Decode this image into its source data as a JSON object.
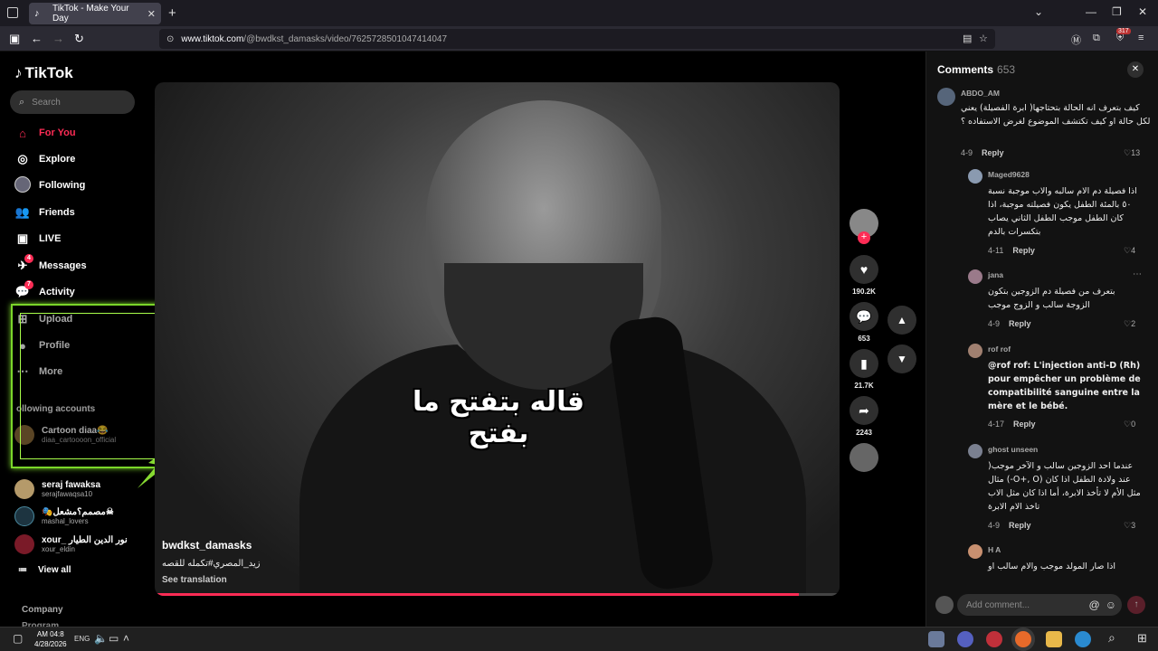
{
  "browser": {
    "tab_title": "TikTok - Make Your Day",
    "new_tab": "+",
    "url_domain": "www.tiktok.com",
    "url_path": "/@bwdkst_damasks/video/7625728501047414047",
    "ext_badge": "317"
  },
  "sidebar": {
    "logo": "TikTok",
    "search_placeholder": "Search",
    "nav": [
      {
        "label": "For You",
        "icon": "home-icon"
      },
      {
        "label": "Explore",
        "icon": "compass-icon"
      },
      {
        "label": "Following",
        "icon": "following-avatar-icon"
      },
      {
        "label": "Friends",
        "icon": "friends-icon"
      },
      {
        "label": "LIVE",
        "icon": "live-icon"
      },
      {
        "label": "Messages",
        "icon": "messages-icon",
        "badge": "4"
      },
      {
        "label": "Activity",
        "icon": "activity-icon",
        "badge": "7"
      },
      {
        "label": "Upload",
        "icon": "upload-icon"
      },
      {
        "label": "Profile",
        "icon": "profile-icon"
      },
      {
        "label": "More",
        "icon": "more-icon"
      }
    ],
    "following_title": "ollowing accounts",
    "accounts": [
      {
        "name": "Cartoon diaa😂",
        "handle": "diaa_cartoooon_official"
      },
      {
        "name": "seraj fawaksa",
        "handle": "serajfawaqsa10"
      },
      {
        "name": "🎭مصمم؟مشعل☠",
        "handle": "mashal_lovers"
      },
      {
        "name": "xour_ نور الدين الطيار",
        "handle": "xour_eldin"
      }
    ],
    "view_all": "View all",
    "company": "Company",
    "program": "Program"
  },
  "video": {
    "caption": "قاله بتفتح ما بفتح",
    "username": "bwdkst_damasks",
    "description": "زيد_المصري#تكمله للقصه",
    "see_translation": "See translation",
    "progress": 0.94
  },
  "actions": {
    "likes": "190.2K",
    "comments": "653",
    "saves": "21.7K",
    "shares": "2243"
  },
  "comments": {
    "title": "Comments",
    "count": "653",
    "reply_label": "Reply",
    "items": [
      {
        "name": "ABDO_AM",
        "text": "كيف بتعرف انه الحالة بتحتاجها( ابرة الفصيلة) يعني لكل حالة او كيف تكتشف الموضوع لغرض الاستفاده ؟",
        "date": "4-9",
        "likes": "13"
      },
      {
        "name": "Maged9628",
        "text": "اذا فصيلة دم الام سالبه والاب موجبة نسبة ٥٠ بالمئة الطفل يكون فصيلته موجبة، اذا كان الطفل موجب الطفل الثاني يصاب بتكسرات بالدم",
        "date": "4-11",
        "likes": "4"
      },
      {
        "name": "jana",
        "text": "بتعرف من فصيلة دم الزوجين بتكون الزوجة سالب و الزوج موجب",
        "date": "4-9",
        "likes": "2"
      },
      {
        "name": "rof rof",
        "text": "@rof rof: L'injection anti-D (Rh) pour empêcher un problème de compatibilité sanguine entre la mère et le bébé.",
        "date": "4-17",
        "likes": "0"
      },
      {
        "name": "ghost unseen",
        "text": "عندما احد الزوجين سالب و الآخر موجب( عند ولادة الطفل اذا كان (O+, O-) مثال مثل الأم لا تأخذ الابرة، أما اذا كان مثل الاب تاخذ الام الابرة",
        "date": "4-9",
        "likes": "3"
      },
      {
        "name": "H A",
        "text": "اذا صار المولد موجب والام سالب او",
        "date": "",
        "likes": ""
      }
    ],
    "input_placeholder": "Add comment..."
  },
  "taskbar": {
    "time": "AM 04:8",
    "date": "4/28/2026",
    "lang": "ENG"
  }
}
